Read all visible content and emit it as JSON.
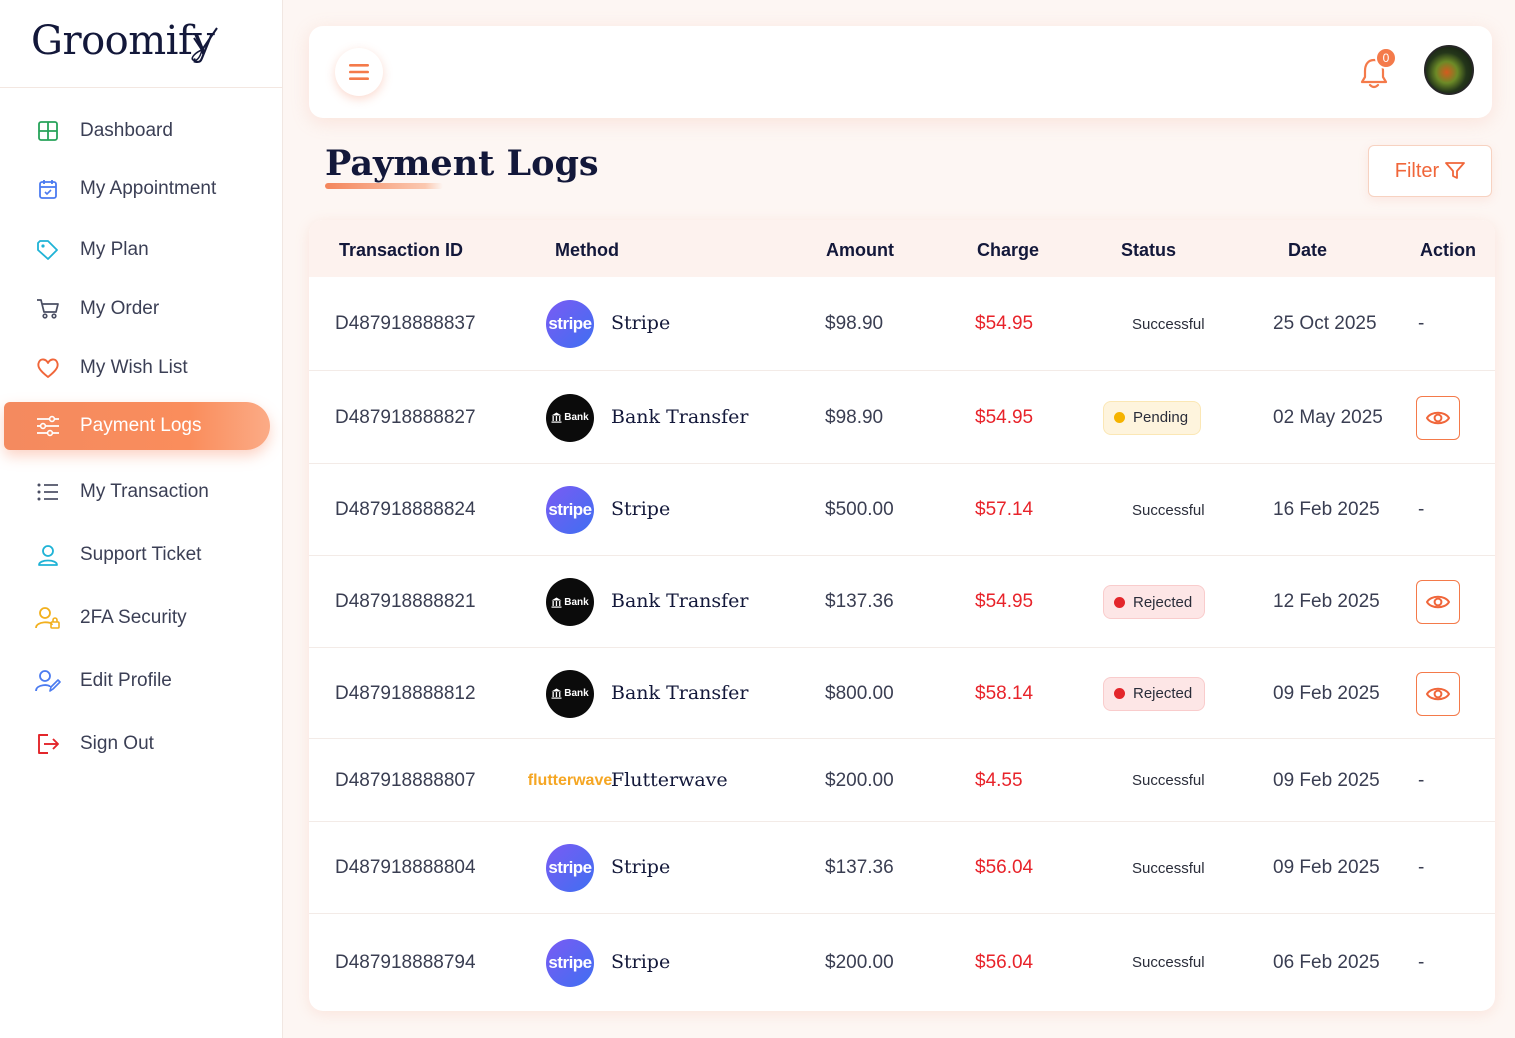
{
  "brand": {
    "name": "Groomify"
  },
  "sidebar": {
    "items": [
      {
        "label": "Dashboard",
        "icon": "grid-icon"
      },
      {
        "label": "My Appointment",
        "icon": "calendar-check-icon"
      },
      {
        "label": "My Plan",
        "icon": "tag-icon"
      },
      {
        "label": "My Order",
        "icon": "cart-icon"
      },
      {
        "label": "My Wish List",
        "icon": "heart-icon"
      },
      {
        "label": "Payment Logs",
        "icon": "sliders-icon",
        "active": true
      },
      {
        "label": "My Transaction",
        "icon": "list-icon"
      },
      {
        "label": "Support Ticket",
        "icon": "user-support-icon"
      },
      {
        "label": "2FA Security",
        "icon": "user-lock-icon"
      },
      {
        "label": "Edit Profile",
        "icon": "user-edit-icon"
      },
      {
        "label": "Sign Out",
        "icon": "sign-out-icon"
      }
    ]
  },
  "topbar": {
    "notification_count": "0"
  },
  "page": {
    "title": "Payment Logs",
    "filter_label": "Filter"
  },
  "table": {
    "headers": {
      "transaction_id": "Transaction ID",
      "method": "Method",
      "amount": "Amount",
      "charge": "Charge",
      "status": "Status",
      "date": "Date",
      "action": "Action"
    },
    "rows": [
      {
        "id": "D487918888837",
        "method": "Stripe",
        "method_logo": "stripe",
        "amount": "$98.90",
        "charge": "$54.95",
        "status": "Successful",
        "date": "25 Oct 2025",
        "action": "-"
      },
      {
        "id": "D487918888827",
        "method": "Bank Transfer",
        "method_logo": "bank",
        "amount": "$98.90",
        "charge": "$54.95",
        "status": "Pending",
        "date": "02 May 2025",
        "action": "view"
      },
      {
        "id": "D487918888824",
        "method": "Stripe",
        "method_logo": "stripe",
        "amount": "$500.00",
        "charge": "$57.14",
        "status": "Successful",
        "date": "16 Feb 2025",
        "action": "-"
      },
      {
        "id": "D487918888821",
        "method": "Bank Transfer",
        "method_logo": "bank",
        "amount": "$137.36",
        "charge": "$54.95",
        "status": "Rejected",
        "date": "12 Feb 2025",
        "action": "view"
      },
      {
        "id": "D487918888812",
        "method": "Bank Transfer",
        "method_logo": "bank",
        "amount": "$800.00",
        "charge": "$58.14",
        "status": "Rejected",
        "date": "09 Feb 2025",
        "action": "view"
      },
      {
        "id": "D487918888807",
        "method": "Flutterwave",
        "method_logo": "flutterwave",
        "amount": "$200.00",
        "charge": "$4.55",
        "status": "Successful",
        "date": "09 Feb 2025",
        "action": "-"
      },
      {
        "id": "D487918888804",
        "method": "Stripe",
        "method_logo": "stripe",
        "amount": "$137.36",
        "charge": "$56.04",
        "status": "Successful",
        "date": "09 Feb 2025",
        "action": "-"
      },
      {
        "id": "D487918888794",
        "method": "Stripe",
        "method_logo": "stripe",
        "amount": "$200.00",
        "charge": "$56.04",
        "status": "Successful",
        "date": "06 Feb 2025",
        "action": "-"
      }
    ]
  },
  "logo_text": {
    "stripe": "stripe",
    "bank": "Bank",
    "flutterwave": "flutterwave"
  },
  "colors": {
    "accent": "#f47a4a",
    "charge": "#e8232a",
    "success": "#13b04a",
    "pending": "#f5b300",
    "rejected": "#e3262b"
  }
}
